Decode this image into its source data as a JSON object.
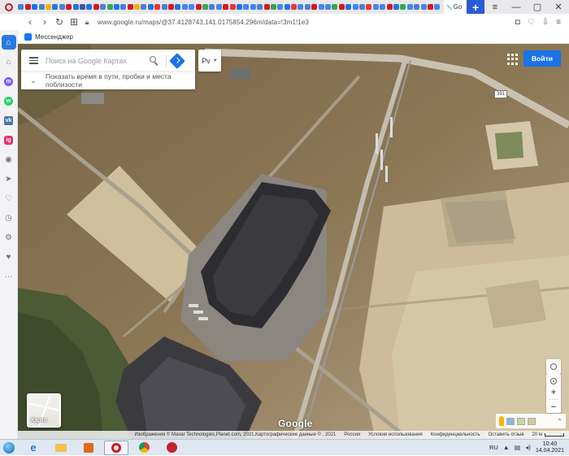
{
  "browser": {
    "tab_title": "Go",
    "new_tab_label": "+",
    "url": "www.google.ru/maps/@37.4128743,141.0175854,296m/data=!3m1!1e3",
    "tab_favicon_colors": [
      "#4a7fd9",
      "#d8161e",
      "#1a73e8",
      "#4a7fd9",
      "#f5b400",
      "#1877f2",
      "#4a7fd9",
      "#d8161e",
      "#1a73e8",
      "#3b5998",
      "#1a73e8",
      "#d8161e",
      "#4a7fd9",
      "#34a853",
      "#1a73e8",
      "#4a7fd9",
      "#d8161e",
      "#f5b400",
      "#4a7fd9",
      "#1a73e8",
      "#e33",
      "#4a7fd9",
      "#d8161e",
      "#1a73e8",
      "#4285f4",
      "#4285f4",
      "#d8161e",
      "#34a853",
      "#4a7fd9",
      "#4285f4",
      "#d8161e",
      "#e33",
      "#1a73e8",
      "#4285f4",
      "#4285f4",
      "#4a7fd9",
      "#d8161e",
      "#34a853",
      "#4285f4",
      "#1a73e8",
      "#e33",
      "#4285f4",
      "#4a7fd9",
      "#d8161e",
      "#4285f4",
      "#4285f4",
      "#34a853",
      "#d8161e",
      "#1a73e8",
      "#4285f4",
      "#4a7fd9",
      "#e33",
      "#4285f4",
      "#4285f4",
      "#d8161e",
      "#1a73e8",
      "#34a853",
      "#4285f4",
      "#4a7fd9",
      "#4285f4",
      "#d8161e",
      "#4285f4"
    ],
    "bookmark": {
      "label": "Мессенджер"
    }
  },
  "map": {
    "search_placeholder": "Поиск на Google Картах",
    "nearby_text": "Показать время в пути, пробки и места поблизости",
    "layer_chip": "Рv",
    "login_label": "Войти",
    "route_shield": "391",
    "minimap_label": "Карта",
    "google_logo": "Google",
    "attribution": {
      "imagery": "Изображения © Maxar Technologies,Planet.com, 2021,Картографические данные © , 2021",
      "links": [
        "Россия",
        "Условия использования",
        "Конфиденциальность",
        "Оставить отзыв"
      ],
      "scale": "20 м"
    }
  },
  "taskbar": {
    "lang": "RU",
    "time": "10:40",
    "date": "14.04.2021"
  }
}
